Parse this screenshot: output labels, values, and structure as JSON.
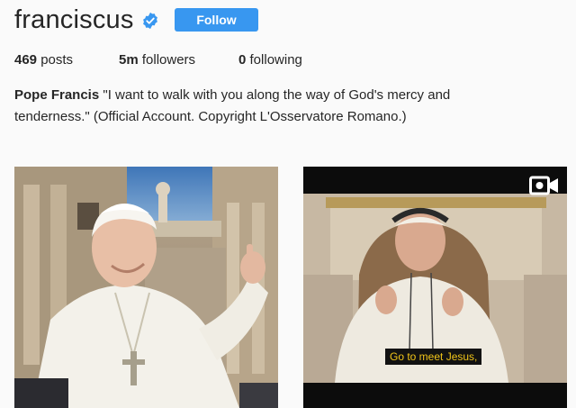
{
  "profile": {
    "username": "franciscus",
    "verified": true,
    "follow_label": "Follow",
    "accent_color": "#3897f0"
  },
  "stats": {
    "posts_count": "469",
    "posts_label": "posts",
    "followers_count": "5m",
    "followers_label": "followers",
    "following_count": "0",
    "following_label": "following"
  },
  "bio": {
    "name": "Pope Francis",
    "text": "\"I want to walk with you along the way of God's mercy and tenderness.\" (Official Account. Copyright L'Osservatore Romano.)"
  },
  "posts": [
    {
      "type": "photo"
    },
    {
      "type": "video",
      "icon": "video-camera-icon",
      "caption": "Go to meet Jesus,"
    }
  ]
}
